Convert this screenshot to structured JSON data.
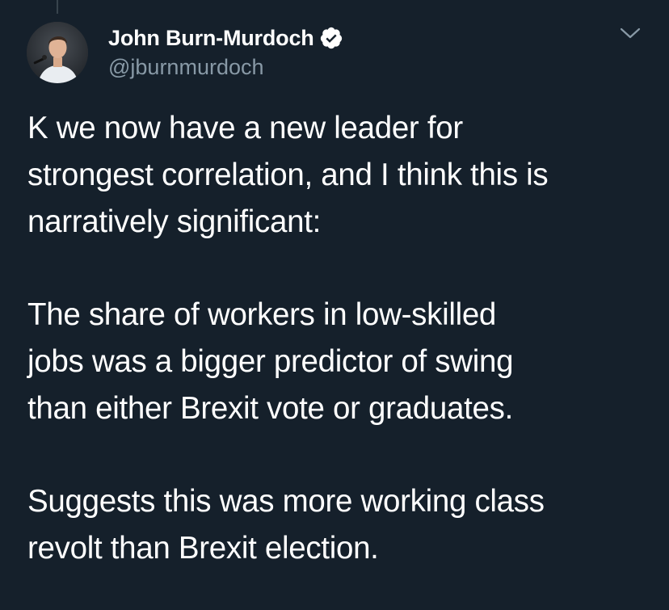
{
  "author": {
    "display_name": "John Burn-Murdoch",
    "handle": "@jburnmurdoch",
    "verified": true,
    "avatar_icon": "profile-photo"
  },
  "menu": {
    "icon": "chevron-down-icon"
  },
  "tweet": {
    "paragraphs": [
      "K we now have a new leader for\nstrongest correlation, and I think this is\nnarratively significant:",
      "The share of workers in low-skilled\njobs was a bigger predictor of swing\nthan either Brexit vote or graduates.",
      "Suggests this was more working class\nrevolt than Brexit election."
    ]
  },
  "colors": {
    "background": "#15202b",
    "text": "#ffffff",
    "secondary_text": "#8899a6",
    "verified_badge": "#ffffff"
  }
}
